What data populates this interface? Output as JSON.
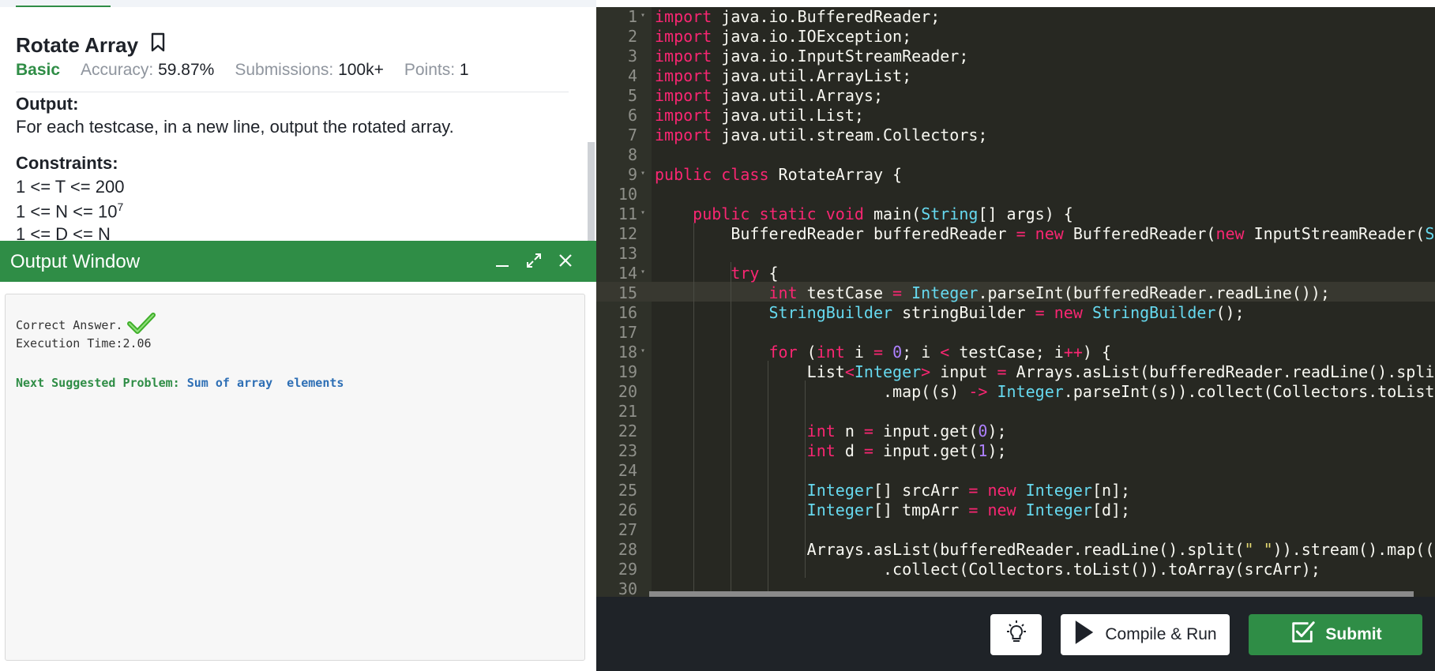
{
  "problem": {
    "title": "Rotate Array",
    "difficulty": "Basic",
    "accuracy_label": "Accuracy:",
    "accuracy_value": "59.87%",
    "submissions_label": "Submissions:",
    "submissions_value": "100k+",
    "points_label": "Points:",
    "points_value": "1",
    "output_heading": "Output:",
    "output_text": "For each testcase, in a new line, output the rotated array.",
    "constraints_heading": "Constraints:",
    "constraint_1": "1 <= T <= 200",
    "constraint_2_base": "1 <= N <= 10",
    "constraint_2_exp": "7",
    "constraint_3": "1 <= D <= N"
  },
  "output_window": {
    "title": "Output Window",
    "result": "Correct Answer.",
    "execution": "Execution Time:2.06",
    "next_label": "Next Suggested Problem:",
    "next_link": "Sum of array  elements"
  },
  "editor": {
    "line_numbers": [
      "1",
      "2",
      "3",
      "4",
      "5",
      "6",
      "7",
      "8",
      "9",
      "10",
      "11",
      "12",
      "13",
      "14",
      "15",
      "16",
      "17",
      "18",
      "19",
      "20",
      "21",
      "22",
      "23",
      "24",
      "25",
      "26",
      "27",
      "28",
      "29",
      "30"
    ],
    "active_line": 15
  },
  "actions": {
    "compile_run": "Compile & Run",
    "submit": "Submit"
  },
  "colors": {
    "brand_green": "#2f8d46",
    "editor_bg": "#272822",
    "link_blue": "#2e6fb5"
  },
  "icons": [
    "bookmark-icon",
    "minimize-icon",
    "expand-icon",
    "close-icon",
    "checkmark-icon",
    "lightbulb-icon",
    "play-icon",
    "submit-check-icon"
  ]
}
